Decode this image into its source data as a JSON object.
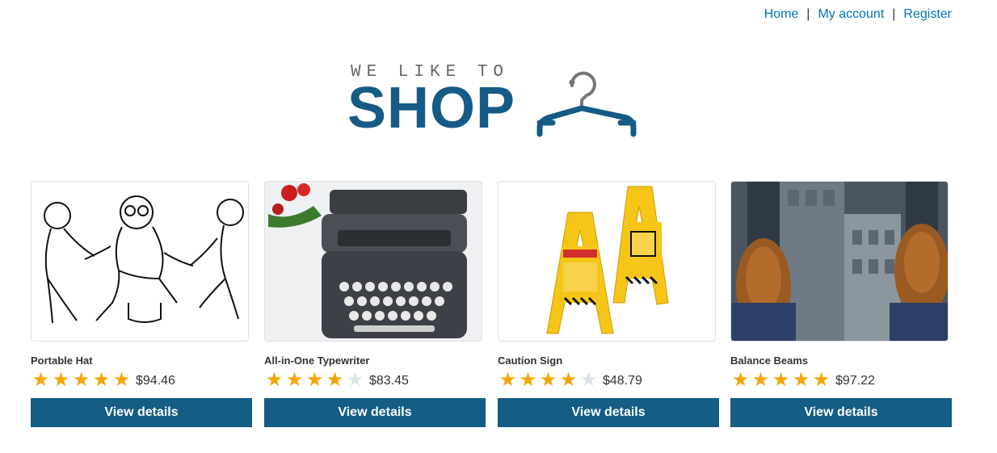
{
  "nav": {
    "home": "Home",
    "account": "My account",
    "register": "Register",
    "separator": "|"
  },
  "logo": {
    "small": "WE LIKE TO",
    "big": "SHOP"
  },
  "colors": {
    "brand": "#155b86",
    "button": "#145d85",
    "star_on": "#f6a400",
    "star_off": "#dde3e7",
    "link": "#0071bc"
  },
  "products": [
    {
      "name": "Portable Hat",
      "rating": 5,
      "price": "$94.46",
      "button": "View details",
      "image_icon": "sketch-people-illustration"
    },
    {
      "name": "All-in-One Typewriter",
      "rating": 4,
      "price": "$83.45",
      "button": "View details",
      "image_icon": "typewriter-photo"
    },
    {
      "name": "Caution Sign",
      "rating": 4,
      "price": "$48.79",
      "button": "View details",
      "image_icon": "caution-sign-photo"
    },
    {
      "name": "Balance Beams",
      "rating": 5,
      "price": "$97.22",
      "button": "View details",
      "image_icon": "feet-over-city-photo"
    }
  ]
}
